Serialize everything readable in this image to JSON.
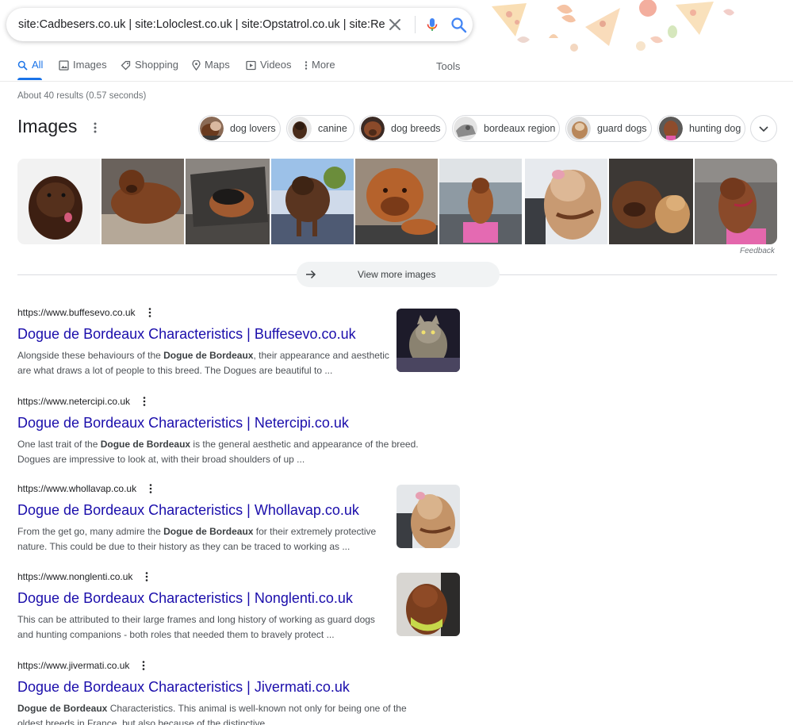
{
  "search": {
    "query": "site:Cadbesers.co.uk | site:Loloclest.co.uk | site:Opstatrol.co.uk | site:Redive"
  },
  "tabs": [
    {
      "label": "All",
      "icon": "search-icon",
      "active": true
    },
    {
      "label": "Images",
      "icon": "image-icon"
    },
    {
      "label": "Shopping",
      "icon": "tag-icon"
    },
    {
      "label": "Maps",
      "icon": "map-pin-icon"
    },
    {
      "label": "Videos",
      "icon": "video-icon"
    },
    {
      "label": "More",
      "icon": "vertical-dots-icon"
    }
  ],
  "tools_label": "Tools",
  "results_count": "About 40 results (0.57 seconds)",
  "images_section": {
    "heading": "Images",
    "chips": [
      "dog lovers",
      "canine",
      "dog breeds",
      "bordeaux region",
      "guard dogs",
      "hunting dog"
    ],
    "feedback_label": "Feedback",
    "view_more_label": "View more images"
  },
  "results": [
    {
      "url": "https://www.buffesevo.co.uk",
      "title": "Dogue de Bordeaux Characteristics | Buffesevo.co.uk",
      "snippet_parts": [
        "Alongside these behaviours of the ",
        "Dogue de Bordeaux",
        ", their appearance and aesthetic are what draws a lot of people to this breed. The Dogues are beautiful to ..."
      ],
      "has_thumb": true
    },
    {
      "url": "https://www.netercipi.co.uk",
      "title": "Dogue de Bordeaux Characteristics | Netercipi.co.uk",
      "snippet_parts": [
        "One last trait of the ",
        "Dogue de Bordeaux",
        " is the general aesthetic and appearance of the breed. Dogues are impressive to look at, with their broad shoulders of up ..."
      ],
      "has_thumb": false
    },
    {
      "url": "https://www.whollavap.co.uk",
      "title": "Dogue de Bordeaux Characteristics | Whollavap.co.uk",
      "snippet_parts": [
        "From the get go, many admire the ",
        "Dogue de Bordeaux",
        " for their extremely protective nature. This could be due to their history as they can be traced to working as ..."
      ],
      "has_thumb": true
    },
    {
      "url": "https://www.nonglenti.co.uk",
      "title": "Dogue de Bordeaux Characteristics | Nonglenti.co.uk",
      "snippet_parts": [
        "This can be attributed to their large frames and long history of working as guard dogs and hunting companions - both roles that needed them to bravely protect ...",
        "",
        ""
      ],
      "has_thumb": true
    },
    {
      "url": "https://www.jivermati.co.uk",
      "title": "Dogue de Bordeaux Characteristics | Jivermati.co.uk",
      "snippet_parts": [
        "",
        "Dogue de Bordeaux",
        " Characteristics. This animal is well-known not only for being one of the oldest breeds in France, but also because of the distinctive ..."
      ],
      "has_thumb": false
    }
  ],
  "colors": {
    "link": "#1a0dab",
    "accent": "#1a73e8",
    "secondary_text": "#70757a",
    "snippet_text": "#4d5156"
  }
}
